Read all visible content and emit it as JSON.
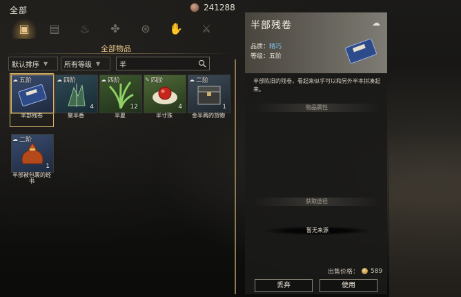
{
  "header": {
    "title": "全部",
    "currency_icon": "copper-coin-icon",
    "currency_amount": "241288"
  },
  "categories": [
    {
      "icon": "box-icon",
      "active": true
    },
    {
      "icon": "scroll-icon",
      "active": false
    },
    {
      "icon": "flame-icon",
      "active": false
    },
    {
      "icon": "herb-icon",
      "active": false
    },
    {
      "icon": "cauldron-icon",
      "active": false
    },
    {
      "icon": "hand-icon",
      "active": false
    },
    {
      "icon": "sword-icon",
      "active": false
    }
  ],
  "section_title": "全部物品",
  "filters": {
    "sort": "默认排序",
    "grade": "所有等级",
    "search_value": "半"
  },
  "items": [
    {
      "grade": "五阶",
      "name": "半部残卷",
      "qty": "",
      "selected": true
    },
    {
      "grade": "四阶",
      "name": "聚半香",
      "qty": "4",
      "selected": false
    },
    {
      "grade": "四阶",
      "name": "半夏",
      "qty": "12",
      "selected": false
    },
    {
      "grade": "四阶",
      "name": "半寸珠",
      "qty": "4",
      "selected": false
    },
    {
      "grade": "二阶",
      "name": "金半两的货物",
      "qty": "1",
      "selected": false
    },
    {
      "grade": "二阶",
      "name": "半部被包裹的经书",
      "qty": "1",
      "selected": false
    }
  ],
  "detail": {
    "name": "半部残卷",
    "quality_label": "品质：",
    "quality_value": "精巧",
    "grade_label": "等级：",
    "grade_value": "五阶",
    "description": "半部陈旧的残卷，看起来似乎可以和另外半本拼凑起来。",
    "attr_header": "物品属性",
    "source_header": "获取途径",
    "source_value": "暂无来源",
    "price_label": "出售价格：",
    "price_value": "589",
    "drop_button": "丢弃",
    "use_button": "使用"
  }
}
